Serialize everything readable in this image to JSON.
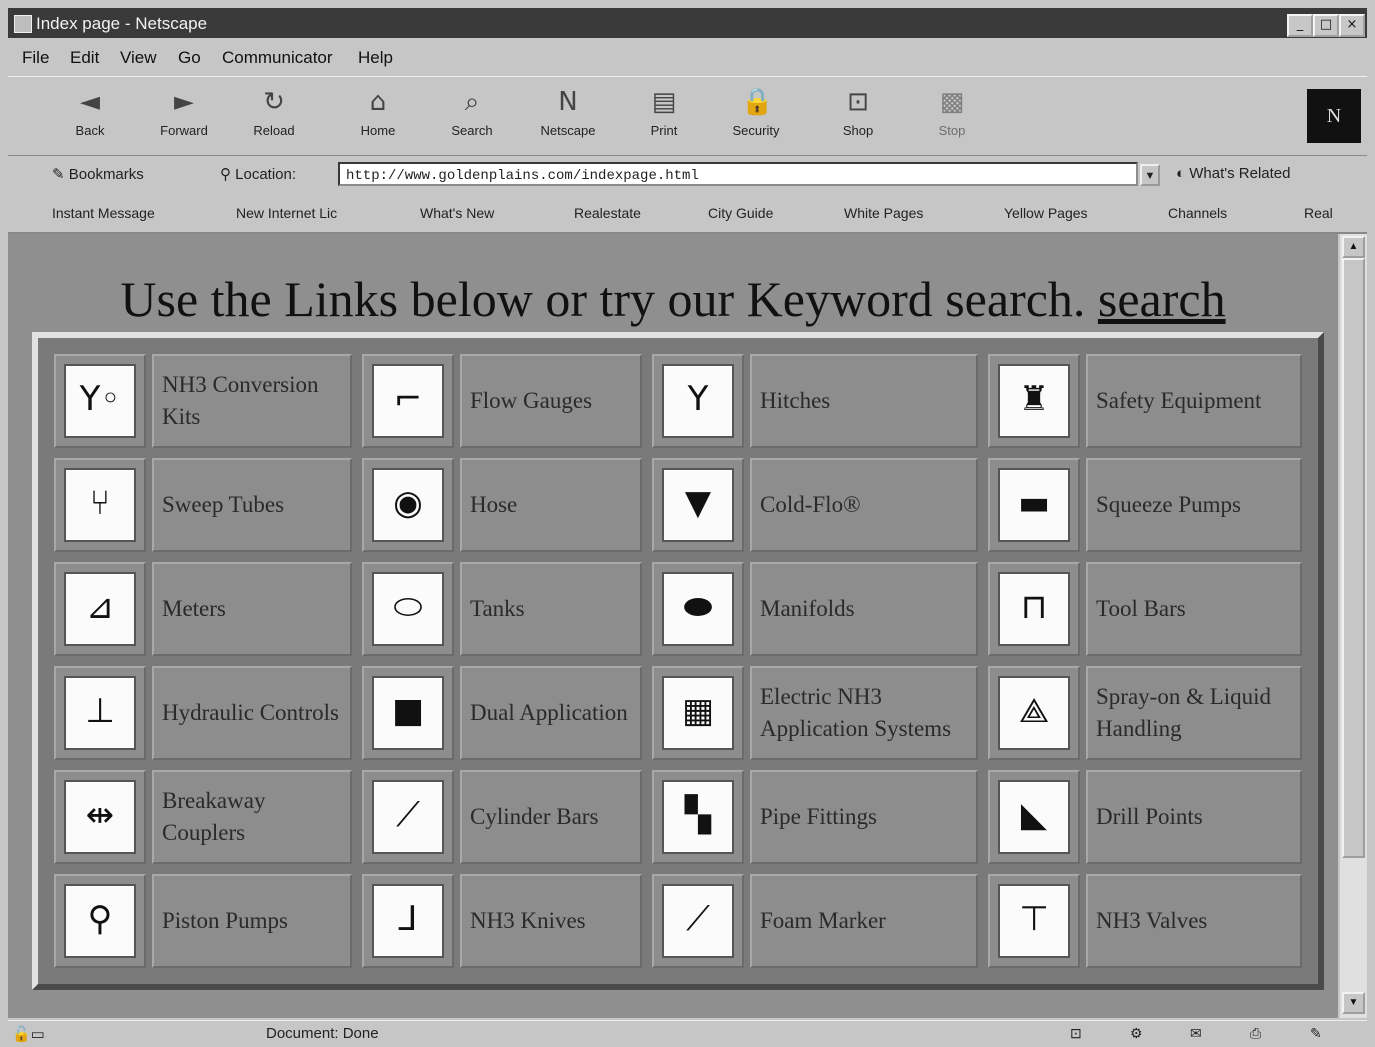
{
  "window": {
    "title": "Index page - Netscape",
    "minimize": "_",
    "maximize": "□",
    "close": "×"
  },
  "menu": [
    "File",
    "Edit",
    "View",
    "Go",
    "Communicator",
    "Help"
  ],
  "toolbar": {
    "buttons": [
      {
        "label": "Back",
        "icon": "back-arrow-icon",
        "glyph": "◄"
      },
      {
        "label": "Forward",
        "icon": "forward-arrow-icon",
        "glyph": "►"
      },
      {
        "label": "Reload",
        "icon": "reload-icon",
        "glyph": "↻"
      },
      {
        "label": "Home",
        "icon": "home-icon",
        "glyph": "⌂"
      },
      {
        "label": "Search",
        "icon": "search-icon",
        "glyph": "⌕"
      },
      {
        "label": "Netscape",
        "icon": "netscape-icon",
        "glyph": "N"
      },
      {
        "label": "Print",
        "icon": "print-icon",
        "glyph": "▤"
      },
      {
        "label": "Security",
        "icon": "lock-icon",
        "glyph": "🔒"
      },
      {
        "label": "Shop",
        "icon": "shopping-bag-icon",
        "glyph": "⊡"
      },
      {
        "label": "Stop",
        "icon": "stop-icon",
        "glyph": "▩"
      }
    ],
    "throbber": "N"
  },
  "location": {
    "bookmarks_label": "Bookmarks",
    "location_label": "Location:",
    "url": "http://www.goldenplains.com/indexpage.html",
    "related_label": "What's Related"
  },
  "personal_bar": [
    "Instant Message",
    "New Internet Lic",
    "What's New",
    "Realestate",
    "City Guide",
    "White Pages",
    "Yellow Pages",
    "Channels",
    "Real"
  ],
  "content": {
    "heading": "Use the Links below or try our Keyword search.",
    "search_link": "search"
  },
  "catalog": [
    {
      "label": "NH3 Conversion Kits",
      "icon": "nh3-conversion-kits-icon",
      "glyph": "Y◦"
    },
    {
      "label": "Flow Gauges",
      "icon": "flow-gauges-icon",
      "glyph": "⌐"
    },
    {
      "label": "Hitches",
      "icon": "hitch-icon",
      "glyph": "Y"
    },
    {
      "label": "Safety Equipment",
      "icon": "safety-equipment-icon",
      "glyph": "♜"
    },
    {
      "label": "Sweep Tubes",
      "icon": "sweep-tubes-icon",
      "glyph": "⑂"
    },
    {
      "label": "Hose",
      "icon": "hose-icon",
      "glyph": "◉"
    },
    {
      "label": "Cold-Flo®",
      "icon": "cold-flo-icon",
      "glyph": "▼"
    },
    {
      "label": "Squeeze Pumps",
      "icon": "squeeze-pump-icon",
      "glyph": "▬"
    },
    {
      "label": "Meters",
      "icon": "meter-icon",
      "glyph": "⊿"
    },
    {
      "label": "Tanks",
      "icon": "tank-icon",
      "glyph": "⬭"
    },
    {
      "label": "Manifolds",
      "icon": "manifold-icon",
      "glyph": "⬬"
    },
    {
      "label": "Tool Bars",
      "icon": "tool-bar-icon",
      "glyph": "⊓"
    },
    {
      "label": "Hydraulic Controls",
      "icon": "hydraulic-controls-icon",
      "glyph": "⊥"
    },
    {
      "label": "Dual Application",
      "icon": "dual-application-icon",
      "glyph": "■"
    },
    {
      "label": "Electric NH3 Application Systems",
      "icon": "electric-nh3-system-icon",
      "glyph": "▦"
    },
    {
      "label": "Spray-on & Liquid Handling",
      "icon": "spray-liquid-icon",
      "glyph": "⟁"
    },
    {
      "label": "Breakaway Couplers",
      "icon": "breakaway-coupler-icon",
      "glyph": "⇹"
    },
    {
      "label": "Cylinder Bars",
      "icon": "cylinder-bar-icon",
      "glyph": "⟋"
    },
    {
      "label": "Pipe Fittings",
      "icon": "pipe-fitting-icon",
      "glyph": "▚"
    },
    {
      "label": "Drill Points",
      "icon": "drill-point-icon",
      "glyph": "◣"
    },
    {
      "label": "Piston Pumps",
      "icon": "piston-pump-icon",
      "glyph": "⚲"
    },
    {
      "label": "NH3 Knives",
      "icon": "nh3-knife-icon",
      "glyph": "⅃"
    },
    {
      "label": "Foam Marker",
      "icon": "foam-marker-icon",
      "glyph": "⟋"
    },
    {
      "label": "NH3 Valves",
      "icon": "nh3-valve-icon",
      "glyph": "⊤"
    }
  ],
  "status": {
    "text": "Document: Done",
    "indicators": [
      "⊡",
      "⚙",
      "✉",
      "⎙",
      "✎"
    ]
  }
}
